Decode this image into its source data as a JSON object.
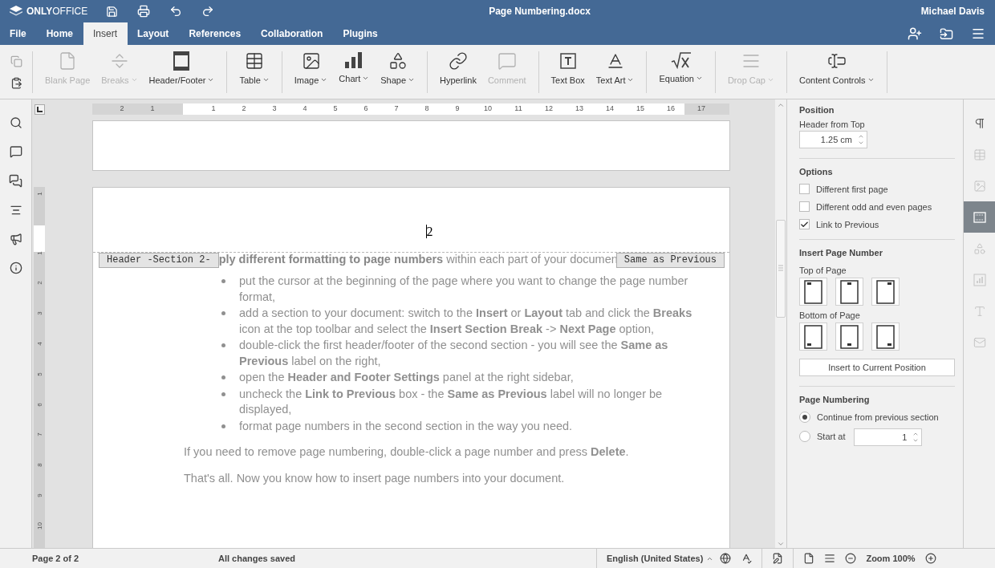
{
  "titlebar": {
    "logo": "**ONLY**OFFICE",
    "title": "Page Numbering.docx",
    "user": "Michael Davis"
  },
  "menu_tabs": [
    {
      "label": "File",
      "selected": false
    },
    {
      "label": "Home",
      "selected": false
    },
    {
      "label": "Insert",
      "selected": true
    },
    {
      "label": "Layout",
      "selected": false
    },
    {
      "label": "References",
      "selected": false
    },
    {
      "label": "Collaboration",
      "selected": false
    },
    {
      "label": "Plugins",
      "selected": false
    }
  ],
  "toolbar": {
    "groups": [
      [
        {
          "kind": "blankpage",
          "label": "Blank Page",
          "caret": false,
          "disabled": true
        },
        {
          "kind": "breaks",
          "label": "Breaks",
          "caret": true,
          "disabled": true
        },
        {
          "kind": "headerfooter",
          "label": "Header/Footer",
          "caret": true,
          "disabled": false
        }
      ],
      [
        {
          "kind": "table",
          "label": "Table",
          "caret": true,
          "disabled": false
        }
      ],
      [
        {
          "kind": "image",
          "label": "Image",
          "caret": true,
          "disabled": false
        },
        {
          "kind": "chart",
          "label": "Chart",
          "caret": true,
          "disabled": false
        },
        {
          "kind": "shape",
          "label": "Shape",
          "caret": true,
          "disabled": false
        }
      ],
      [
        {
          "kind": "hyperlink",
          "label": "Hyperlink",
          "caret": false,
          "disabled": false
        },
        {
          "kind": "comment",
          "label": "Comment",
          "caret": false,
          "disabled": true
        }
      ],
      [
        {
          "kind": "textbox",
          "label": "Text Box",
          "caret": false,
          "disabled": false
        },
        {
          "kind": "textart",
          "label": "Text Art",
          "caret": true,
          "disabled": false
        }
      ],
      [
        {
          "kind": "equation",
          "label": "Equation",
          "caret": true,
          "disabled": false
        }
      ],
      [
        {
          "kind": "dropcap",
          "label": "Drop Cap",
          "caret": true,
          "disabled": true
        }
      ],
      [
        {
          "kind": "contentcontrols",
          "label": "Content Controls",
          "caret": true,
          "disabled": false
        }
      ]
    ]
  },
  "ruler": {
    "h_labels": [
      "2",
      "1",
      "1",
      "2",
      "3",
      "4",
      "5",
      "6",
      "7",
      "8",
      "9",
      "10",
      "11",
      "12",
      "13",
      "14",
      "15",
      "16",
      "17"
    ],
    "v_labels": [
      "1",
      "1",
      "2",
      "3",
      "4",
      "5",
      "6",
      "7",
      "8",
      "9",
      "10"
    ]
  },
  "document": {
    "page_number": "2",
    "header_label": "Header -Section 2-",
    "same_as_previous": "Same as Previous",
    "first_line": "**ply different formatting to page numbers** within each part of your documen",
    "bullets": [
      "put the cursor at the beginning of the page where you want to change the page number format,",
      "add a section to your document: switch to the **Insert** or **Layout** tab and click the **Breaks** icon at the top toolbar and select the **Insert Section Break** -> **Next Page** option,",
      "double-click the first header/footer of the second section - you will see the **Same as Previous** label on the right,",
      "open the **Header and Footer Settings**  panel at the right sidebar,",
      "uncheck the **Link to Previous** box - the **Same as Previous** label will no longer be displayed,",
      "format page numbers in the second section in the way you need."
    ],
    "paragraphs": [
      "If you need to remove page numbering, double-click a page number and press **Delete**.",
      "That's all. Now you know how to insert page numbers into your document."
    ]
  },
  "panel": {
    "position_title": "Position",
    "header_from_top_label": "Header from Top",
    "header_from_top": "1.25 cm",
    "options_title": "Options",
    "options": [
      {
        "label": "Different first page",
        "checked": false
      },
      {
        "label": "Different odd and even pages",
        "checked": false
      },
      {
        "label": "Link to Previous",
        "checked": true
      }
    ],
    "insert_title": "Insert Page Number",
    "top_label": "Top of Page",
    "top_positions": [
      {
        "kind": "left"
      },
      {
        "kind": "center"
      },
      {
        "kind": "right"
      }
    ],
    "bottom_label": "Bottom of Page",
    "bottom_positions": [
      {
        "kind": "left"
      },
      {
        "kind": "center"
      },
      {
        "kind": "right"
      }
    ],
    "insert_button": "Insert to Current Position",
    "numbering_title": "Page Numbering",
    "numbering": [
      {
        "label": "Continue from previous section",
        "selected": true
      },
      {
        "label": "Start at",
        "selected": false,
        "value": "1"
      }
    ]
  },
  "right_tabs": [
    {
      "kind": "paragraph",
      "selected": false,
      "disabled": false
    },
    {
      "kind": "table",
      "selected": false,
      "disabled": true
    },
    {
      "kind": "image",
      "selected": false,
      "disabled": true
    },
    {
      "kind": "headerfooter",
      "selected": true
    },
    {
      "kind": "shape",
      "selected": false,
      "disabled": true
    },
    {
      "kind": "chart",
      "selected": false,
      "disabled": true
    },
    {
      "kind": "textart",
      "selected": false,
      "disabled": true
    },
    {
      "kind": "mailmerge",
      "selected": false,
      "disabled": true
    }
  ],
  "status_bar": {
    "page": "Page 2 of 2",
    "saved": "All changes saved",
    "language": "English (United States)",
    "zoom": "Zoom 100%"
  }
}
